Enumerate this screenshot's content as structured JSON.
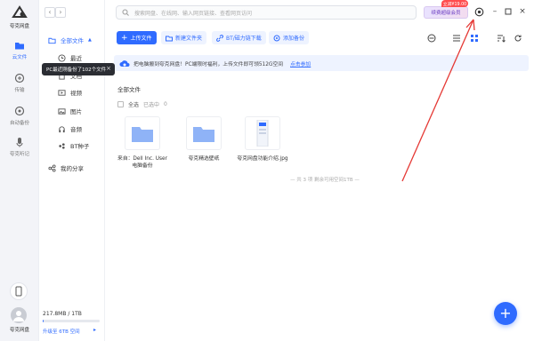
{
  "app": {
    "name": "夸克网盘"
  },
  "rail": {
    "items": [
      {
        "label": "云文件",
        "icon": "folder-icon",
        "active": true
      },
      {
        "label": "传输",
        "icon": "transfer-icon"
      },
      {
        "label": "自动备份",
        "icon": "backup-icon"
      },
      {
        "label": "夸克听记",
        "icon": "microphone-icon"
      }
    ],
    "user_label": "夸克网盘"
  },
  "sidebar": {
    "all_files": "全部文件",
    "items": [
      {
        "label": "最近",
        "icon": "clock-icon"
      },
      {
        "label": "文档",
        "icon": "document-icon"
      },
      {
        "label": "视频",
        "icon": "video-icon"
      },
      {
        "label": "图片",
        "icon": "image-icon"
      },
      {
        "label": "音频",
        "icon": "headphones-icon"
      },
      {
        "label": "BT种子",
        "icon": "seed-icon"
      }
    ],
    "my_share": "我的分享",
    "storage": "217.8MB / 1TB",
    "storage_fraction": 0.0002,
    "upgrade": "升级至 6TB 空间"
  },
  "tooltip": {
    "text": "PC最近刚备份了102个文件"
  },
  "topbar": {
    "search_placeholder": "搜索网盘、在线网、输入网页链接、查看网页访问",
    "vip_label": "续费超级会员",
    "vip_badge": "立减¥19.00"
  },
  "toolbar": {
    "upload": "上传文件",
    "new_folder": "新建文件夹",
    "bt_download": "BT/磁力链下载",
    "add_backup": "添加备份"
  },
  "banner": {
    "text": "把电脑搬到夸克网盘！PC端限时福利，上传文件即可领512G空间",
    "link": "点击参加"
  },
  "main": {
    "crumb": "全部文件",
    "select_all": "全选",
    "selected": "已选中",
    "selected_count": "0",
    "files": [
      {
        "name": "来自：Dell Inc. User 电脑备份",
        "type": "folder"
      },
      {
        "name": "夸克精选壁纸",
        "type": "folder"
      },
      {
        "name": "夸克网盘功能介绍.jpg",
        "type": "image"
      }
    ],
    "footer": "— 共 3 项 剩余可用空间1TB —"
  },
  "colors": {
    "accent": "#2f6bff",
    "folder": "#8fb3f7",
    "arrow": "#e53935"
  }
}
